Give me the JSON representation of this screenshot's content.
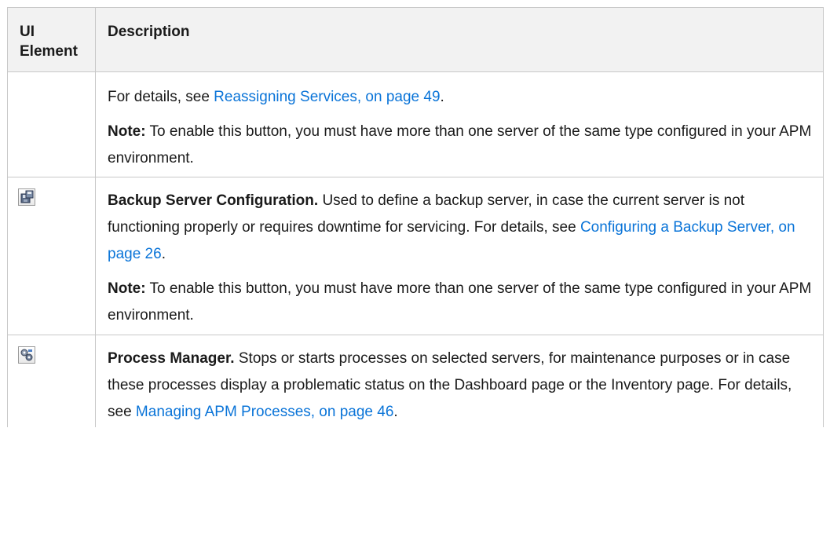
{
  "table": {
    "header": {
      "ui_element": "UI Element",
      "description": "Description"
    },
    "row1": {
      "p1_text": "For details, see ",
      "p1_link": "Reassigning Services, on page 49",
      "p1_end": ".",
      "note_label": "Note:",
      "note_text": " To enable this button, you must have more than one server of the same type configured in your APM environment."
    },
    "row2": {
      "icon": "backup-server-configuration-icon",
      "title": "Backup Server Configuration.",
      "text": " Used to define a backup server, in case the current server is not functioning properly or requires downtime for servicing. For details, see ",
      "link": "Configuring a Backup Server, on page 26",
      "end": ".",
      "note_label": "Note:",
      "note_text": " To enable this button, you must have more than one server of the same type configured in your APM environment."
    },
    "row3": {
      "icon": "process-manager-icon",
      "title": "Process Manager.",
      "text": " Stops or starts processes on selected servers, for maintenance purposes or in case these processes display a problematic status on the Dashboard page or the Inventory page. For details, see ",
      "link": "Managing APM Processes, on page 46",
      "end": "."
    }
  },
  "colors": {
    "link": "#0a74d8",
    "header_bg": "#f2f2f2",
    "border": "#c8c8c8"
  }
}
